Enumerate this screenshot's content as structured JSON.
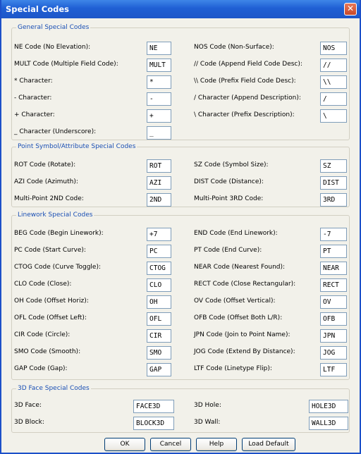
{
  "window": {
    "title": "Special Codes"
  },
  "general": {
    "legend": "General Special Codes",
    "rows": [
      {
        "label_left": "NE Code (No Elevation):",
        "value_left": "NE",
        "label_right": "NOS Code (Non-Surface):",
        "value_right": "NOS"
      },
      {
        "label_left": "MULT Code (Multiple Field Code):",
        "value_left": "MULT",
        "label_right": "// Code (Append Field Code Desc):",
        "value_right": "//"
      },
      {
        "label_left": "* Character:",
        "value_left": "*",
        "label_right": "\\\\ Code (Prefix Field Code Desc):",
        "value_right": "\\\\"
      },
      {
        "label_left": "- Character:",
        "value_left": "-",
        "label_right": "/ Character (Append Description):",
        "value_right": "/"
      },
      {
        "label_left": "+ Character:",
        "value_left": "+",
        "label_right": "\\ Character (Prefix Description):",
        "value_right": "\\"
      },
      {
        "label_left": "_ Character (Underscore):",
        "value_left": "_"
      }
    ]
  },
  "point": {
    "legend": "Point Symbol/Attribute Special Codes",
    "rows": [
      {
        "label_left": "ROT Code (Rotate):",
        "value_left": "ROT",
        "label_right": "SZ Code (Symbol Size):",
        "value_right": "SZ"
      },
      {
        "label_left": "AZI Code (Azimuth):",
        "value_left": "AZI",
        "label_right": "DIST Code (Distance):",
        "value_right": "DIST"
      },
      {
        "label_left": "Multi-Point 2ND Code:",
        "value_left": "2ND",
        "label_right": "Multi-Point 3RD Code:",
        "value_right": "3RD"
      }
    ]
  },
  "linework": {
    "legend": "Linework Special Codes",
    "rows": [
      {
        "label_left": "BEG Code (Begin Linework):",
        "value_left": "+7",
        "label_right": "END Code (End Linework):",
        "value_right": "-7"
      },
      {
        "label_left": "PC Code (Start Curve):",
        "value_left": "PC",
        "label_right": "PT Code (End Curve):",
        "value_right": "PT"
      },
      {
        "label_left": "CTOG Code (Curve Toggle):",
        "value_left": "CTOG",
        "label_right": "NEAR Code (Nearest Found):",
        "value_right": "NEAR"
      },
      {
        "label_left": "CLO Code (Close):",
        "value_left": "CLO",
        "label_right": "RECT Code (Close Rectangular):",
        "value_right": "RECT"
      },
      {
        "label_left": "OH Code (Offset Horiz):",
        "value_left": "OH",
        "label_right": "OV Code (Offset Vertical):",
        "value_right": "OV"
      },
      {
        "label_left": "OFL Code (Offset Left):",
        "value_left": "OFL",
        "label_right": "OFB Code (Offset Both L/R):",
        "value_right": "OFB"
      },
      {
        "label_left": "CIR Code (Circle):",
        "value_left": "CIR",
        "label_right": "JPN Code (Join to Point Name):",
        "value_right": "JPN"
      },
      {
        "label_left": "SMO Code (Smooth):",
        "value_left": "SMO",
        "label_right": "JOG Code (Extend By Distance):",
        "value_right": "JOG"
      },
      {
        "label_left": "GAP Code (Gap):",
        "value_left": "GAP",
        "label_right": "LTF Code (Linetype Flip):",
        "value_right": "LTF"
      }
    ]
  },
  "face3d": {
    "legend": "3D Face Special Codes",
    "rows": [
      {
        "label_left": "3D Face:",
        "value_left": "FACE3D",
        "label_right": "3D Hole:",
        "value_right": "HOLE3D"
      },
      {
        "label_left": "3D Block:",
        "value_left": "BLOCK3D",
        "label_right": "3D Wall:",
        "value_right": "WALL3D"
      }
    ]
  },
  "buttons": {
    "ok": "OK",
    "cancel": "Cancel",
    "help": "Help",
    "load_default": "Load Default"
  }
}
